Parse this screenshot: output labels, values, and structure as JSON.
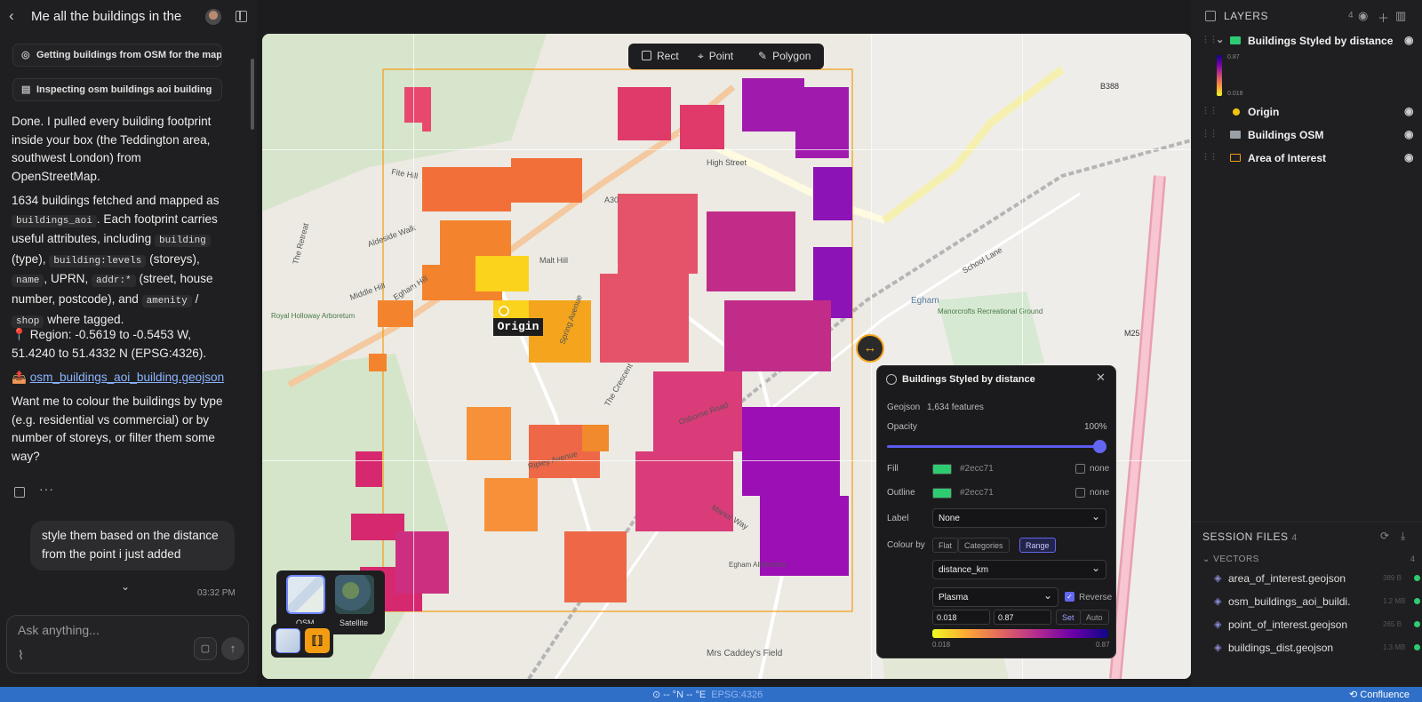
{
  "chat": {
    "title": "Me all the buildings in the",
    "tool_steps": [
      {
        "icon": "globe-icon",
        "label": "Getting buildings from OSM for the map ..."
      },
      {
        "icon": "file-icon",
        "label": "Inspecting osm buildings aoi building"
      }
    ],
    "p1": "Done. I pulled every building footprint inside your box (the Teddington area, southwest London) from OpenStreetMap.",
    "p2_a": "1634 buildings fetched and mapped as",
    "p2_code1": "buildings_aoi",
    "p2_b": ". Each footprint carries useful attributes, including",
    "p2_code2": "building",
    "p2_c": "(type),",
    "p2_code3": "building:levels",
    "p2_d": "(storeys),",
    "p2_code4": "name",
    "p2_e": ", UPRN,",
    "p2_code5": "addr:*",
    "p2_f": "(street, house number, postcode), and",
    "p2_code6": "amenity",
    "p2_g": "/",
    "p2_code7": "shop",
    "p2_h": "where tagged.",
    "region_icon": "📍",
    "region": "Region: -0.5619 to -0.5453 W, 51.4240 to 51.4332 N (EPSG:4326).",
    "file_icon": "📤",
    "file_link": "osm_buildings_aoi_building.geojson",
    "question": "Want me to colour the buildings by type (e.g. residential vs commercial) or by number of storeys, or filter them some way?",
    "actions_dots": "···",
    "user_message": "style them based on the distance from the point i just added",
    "time": "03:32 PM",
    "input_placeholder": "Ask anything..."
  },
  "map": {
    "draw_tools": [
      "Rect",
      "Point",
      "Polygon"
    ],
    "origin_label": "Origin",
    "swipe_glyph": "↔",
    "basemaps": [
      "OSM",
      "Satellite"
    ],
    "street_labels": [
      "High Street",
      "Egham Hill",
      "Malt Hill",
      "Spring Avenue",
      "The Crescent",
      "Osborne Road",
      "Ripley Avenue",
      "Manor Way",
      "Egham",
      "Manorcrofts Recreational Ground",
      "School Lane",
      "B388",
      "A30",
      "M25",
      "Mrs Caddey's Field",
      "Egham Allotments",
      "Middle Hill",
      "Aldeside Walk",
      "Fite Hill",
      "The Retreat",
      "Royal Holloway Arboretum"
    ]
  },
  "style_panel": {
    "title": "Buildings Styled by distance",
    "type": "Geojson",
    "features": "1,634 features",
    "opacity_label": "Opacity",
    "opacity_value": "100%",
    "opacity": 1.0,
    "fill_label": "Fill",
    "fill_color": "#2ecc71",
    "outline_label": "Outline",
    "outline_color": "#2ecc71",
    "none_label": "none",
    "label_label": "Label",
    "label_value": "None",
    "colour_by_label": "Colour by",
    "modes": [
      "Flat",
      "Categories",
      "Range"
    ],
    "active_mode": "Range",
    "field": "distance_km",
    "palette": "Plasma",
    "reverse_label": "Reverse",
    "reverse": true,
    "min": "0.018",
    "max": "0.87",
    "set_label": "Set",
    "auto_label": "Auto",
    "ramp_min": "0.018",
    "ramp_max": "0.87"
  },
  "layers": {
    "title": "LAYERS",
    "count": "4",
    "items": [
      {
        "name": "Buildings Styled by distance",
        "symbol": "#2ecc71",
        "legend_max": "0.87",
        "legend_min": "0.018"
      },
      {
        "name": "Origin",
        "symbol": "#f1c40f"
      },
      {
        "name": "Buildings OSM",
        "symbol": "#9aa0a6"
      },
      {
        "name": "Area of Interest",
        "symbol": "#f39c12"
      }
    ]
  },
  "session_files": {
    "title": "SESSION FILES",
    "count": "4",
    "group": "VECTORS",
    "group_count": "4",
    "files": [
      {
        "name": "area_of_interest.geojson",
        "size": "389 B"
      },
      {
        "name": "osm_buildings_aoi_buildi...",
        "size": "1.2 MB"
      },
      {
        "name": "point_of_interest.geojson",
        "size": "265 B"
      },
      {
        "name": "buildings_dist.geojson",
        "size": "1.3 MB"
      }
    ]
  },
  "status": {
    "coords": "-- °N -- °E",
    "epsg": "EPSG:4326",
    "app": "Confluence"
  }
}
